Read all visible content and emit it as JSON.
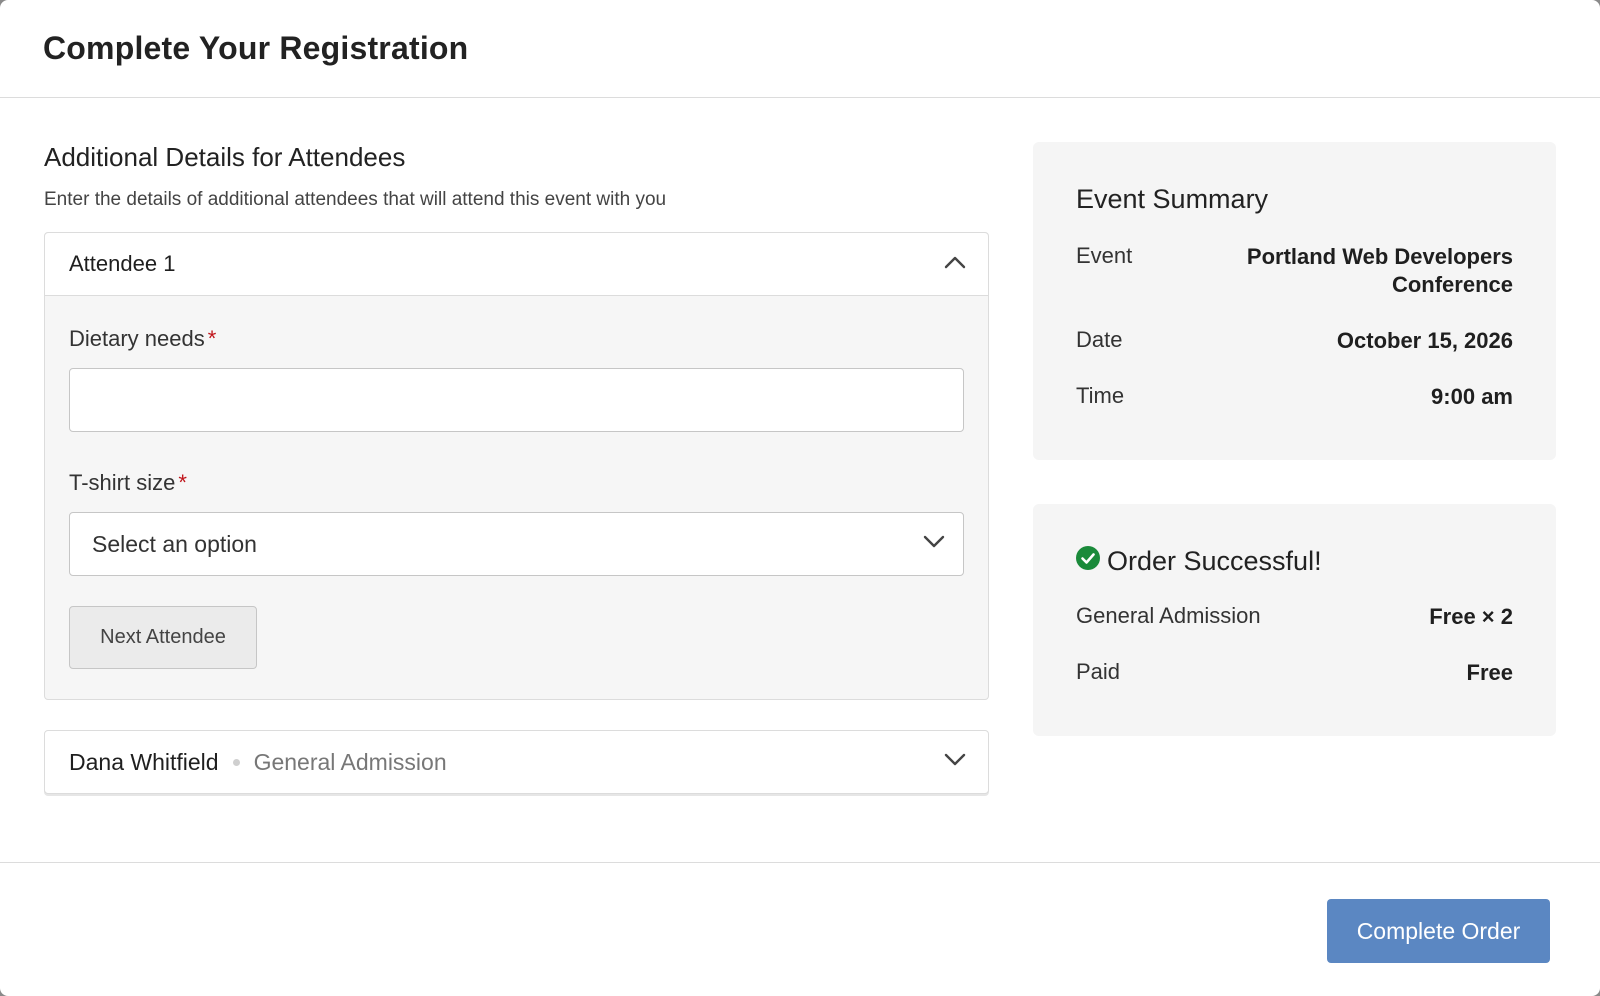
{
  "modal": {
    "title": "Complete Your Registration"
  },
  "attendees": {
    "section_title": "Additional Details for Attendees",
    "section_desc": "Enter the details of additional attendees that will attend this event with you",
    "expanded": {
      "title": "Attendee 1",
      "dietary_label": "Dietary needs",
      "dietary_value": "",
      "tshirt_label": "T-shirt size",
      "tshirt_value": "Select an option",
      "required_mark": "*",
      "next_label": "Next Attendee"
    },
    "collapsed": {
      "name": "Dana Whitfield",
      "ticket": "General Admission"
    }
  },
  "summary": {
    "title": "Event Summary",
    "event_label": "Event",
    "event_value_line1": "Portland Web Developers",
    "event_value_line2": "Conference",
    "date_label": "Date",
    "date_value": "October 15, 2026",
    "time_label": "Time",
    "time_value": "9:00 am"
  },
  "order": {
    "title": "Order Successful!",
    "ticket_label": "General Admission",
    "ticket_value": "Free × 2",
    "paid_label": "Paid",
    "paid_value": "Free",
    "success_color": "#1a8a3a"
  },
  "footer": {
    "complete_label": "Complete Order",
    "button_color": "#5b87c2"
  }
}
